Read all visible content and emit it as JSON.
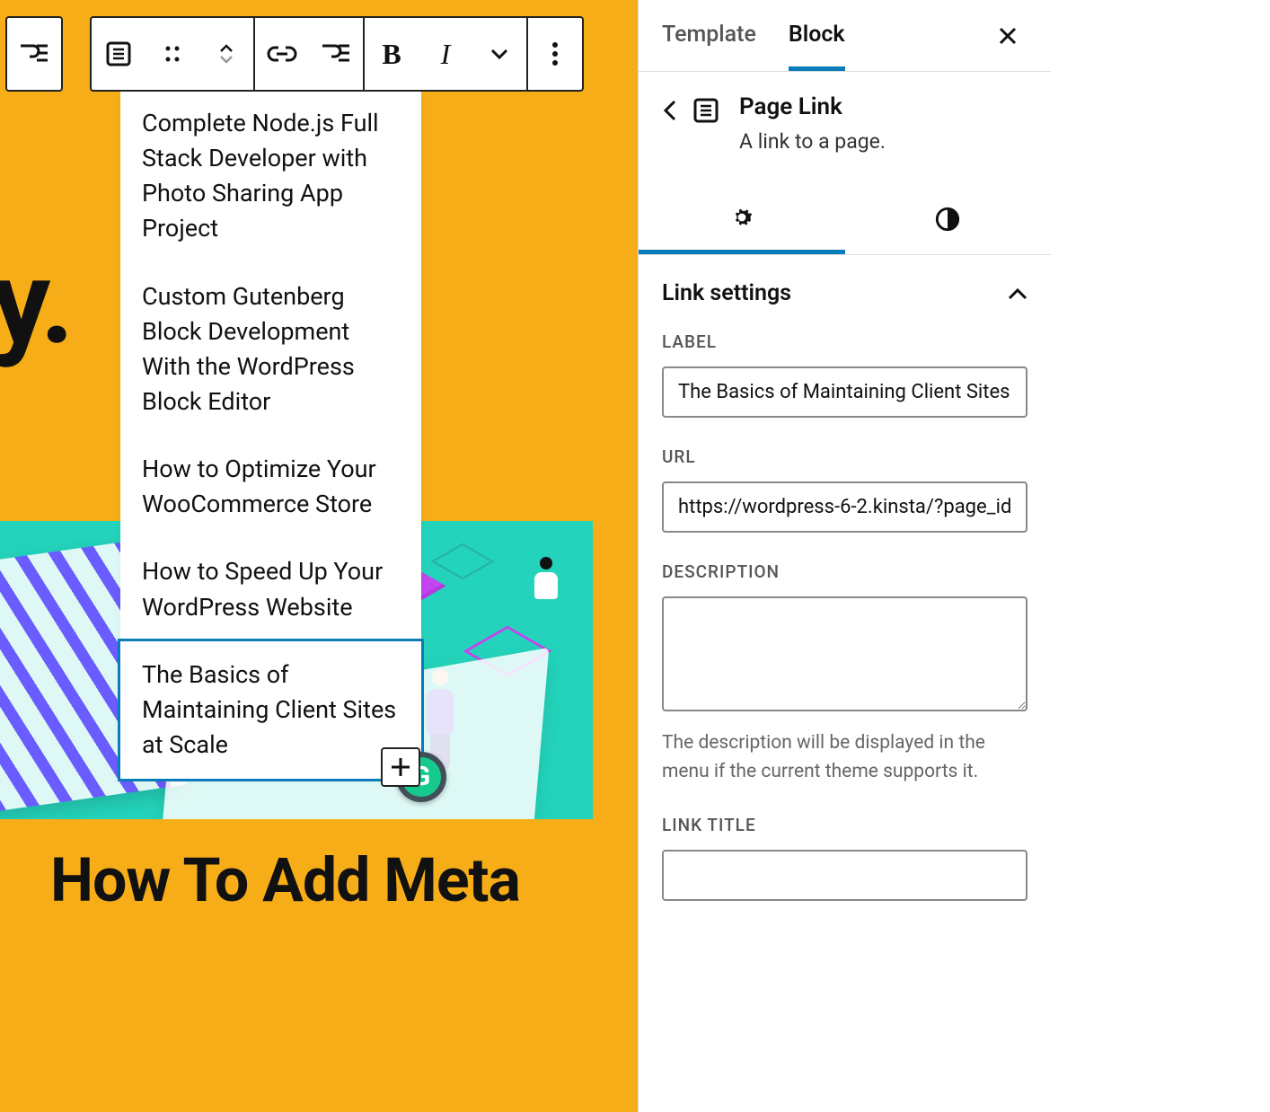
{
  "toolbar": {
    "submenu_label": "Add submenu",
    "page_type_label": "Select page",
    "drag_label": "Drag",
    "move_label": "Move up/down",
    "link_label": "Link",
    "submenu2_label": "Add submenu",
    "bold_label": "Bold",
    "italic_label": "Italic",
    "more_rich_label": "More rich text controls",
    "options_label": "Options"
  },
  "nav_items": [
    "Complete Node.js Full Stack Developer with Photo Sharing App Project",
    "Custom Gutenberg Block Development With the WordPress Block Editor",
    "How to Optimize Your WooCommerce Store",
    "How to Speed Up Your WordPress Website",
    "The Basics of Maintaining Client Sites at Scale"
  ],
  "background_fragment": "hy.",
  "bottom_heading": "How To Add Meta",
  "add_button": "+",
  "sidebar": {
    "tabs": {
      "template": "Template",
      "block": "Block"
    },
    "block": {
      "title": "Page Link",
      "desc": "A link to a page."
    },
    "subtabs": {
      "settings": "Settings",
      "styles": "Styles"
    },
    "link_settings": {
      "heading": "Link settings",
      "label_label": "LABEL",
      "label_value": "The Basics of Maintaining Client Sites",
      "url_label": "URL",
      "url_value": "https://wordpress-6-2.kinsta/?page_id",
      "desc_label": "DESCRIPTION",
      "desc_value": "",
      "desc_help": "The description will be displayed in the menu if the current theme supports it.",
      "title_label": "LINK TITLE",
      "title_value": ""
    }
  }
}
